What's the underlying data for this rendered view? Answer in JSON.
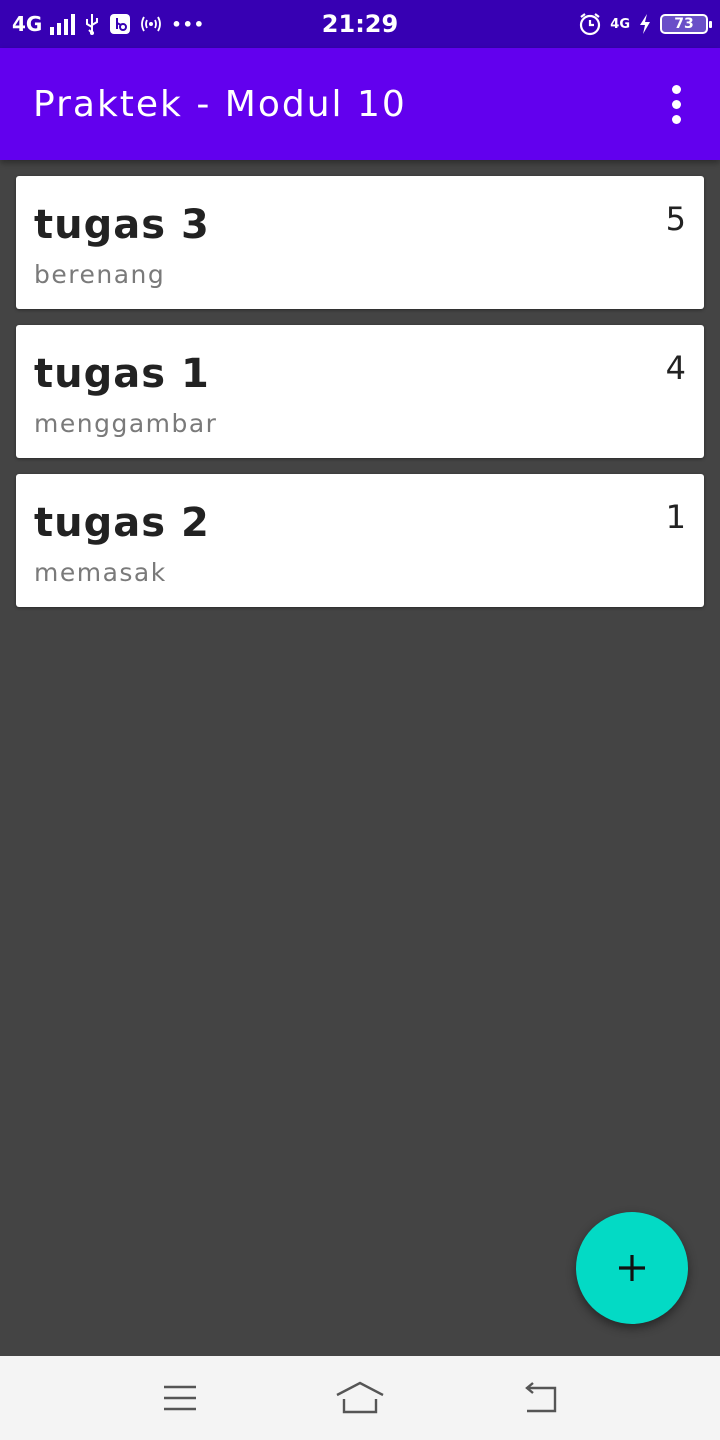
{
  "status_bar": {
    "network": "4G",
    "time": "21:29",
    "alarm_network": "4G",
    "battery": "73",
    "dots": "•••",
    "icons": [
      "signal-icon",
      "usb-icon",
      "usb-debug-icon",
      "hotspot-icon",
      "alarm-icon",
      "charging-icon",
      "battery-icon"
    ]
  },
  "app_bar": {
    "title": "Praktek - Modul 10",
    "menu_icon": "more-vert-icon"
  },
  "tasks": [
    {
      "title": "tugas 3",
      "description": "berenang",
      "priority": "5"
    },
    {
      "title": "tugas 1",
      "description": "menggambar",
      "priority": "4"
    },
    {
      "title": "tugas 2",
      "description": "memasak",
      "priority": "1"
    }
  ],
  "fab": {
    "icon": "add-icon"
  },
  "nav_bar": {
    "icons": [
      "menu-icon",
      "home-icon",
      "back-icon"
    ]
  },
  "colors": {
    "status_bar": "#3700B3",
    "app_bar": "#6200EE",
    "background": "#444444",
    "fab": "#03DAC5",
    "card": "#FFFFFF"
  }
}
